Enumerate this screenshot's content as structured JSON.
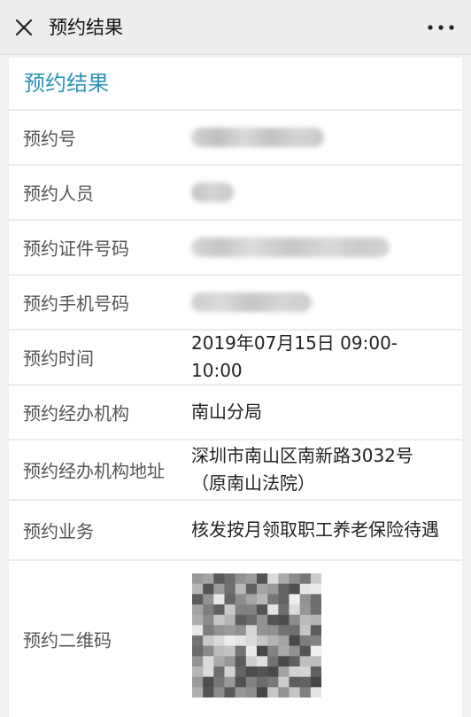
{
  "nav": {
    "title": "预约结果",
    "close_icon": "close-icon",
    "more_icon": "more-dots-icon"
  },
  "card": {
    "heading": "预约结果",
    "accent_color": "#2c95b6"
  },
  "fields": {
    "booking_number": {
      "label": "预约号",
      "redacted": true
    },
    "booker_name": {
      "label": "预约人员",
      "redacted": true
    },
    "id_number": {
      "label": "预约证件号码",
      "redacted": true
    },
    "phone_number": {
      "label": "预约手机号码",
      "redacted": true
    },
    "time": {
      "label": "预约时间",
      "value": "2019年07月15日 09:00-10:00"
    },
    "office": {
      "label": "预约经办机构",
      "value": "南山分局"
    },
    "office_address": {
      "label": "预约经办机构地址",
      "value": "深圳市南山区南新路3032号（原南山法院）"
    },
    "business": {
      "label": "预约业务",
      "value": "核发按月领取职工养老保险待遇"
    },
    "qr_code": {
      "label": "预约二维码",
      "redacted": true
    }
  }
}
